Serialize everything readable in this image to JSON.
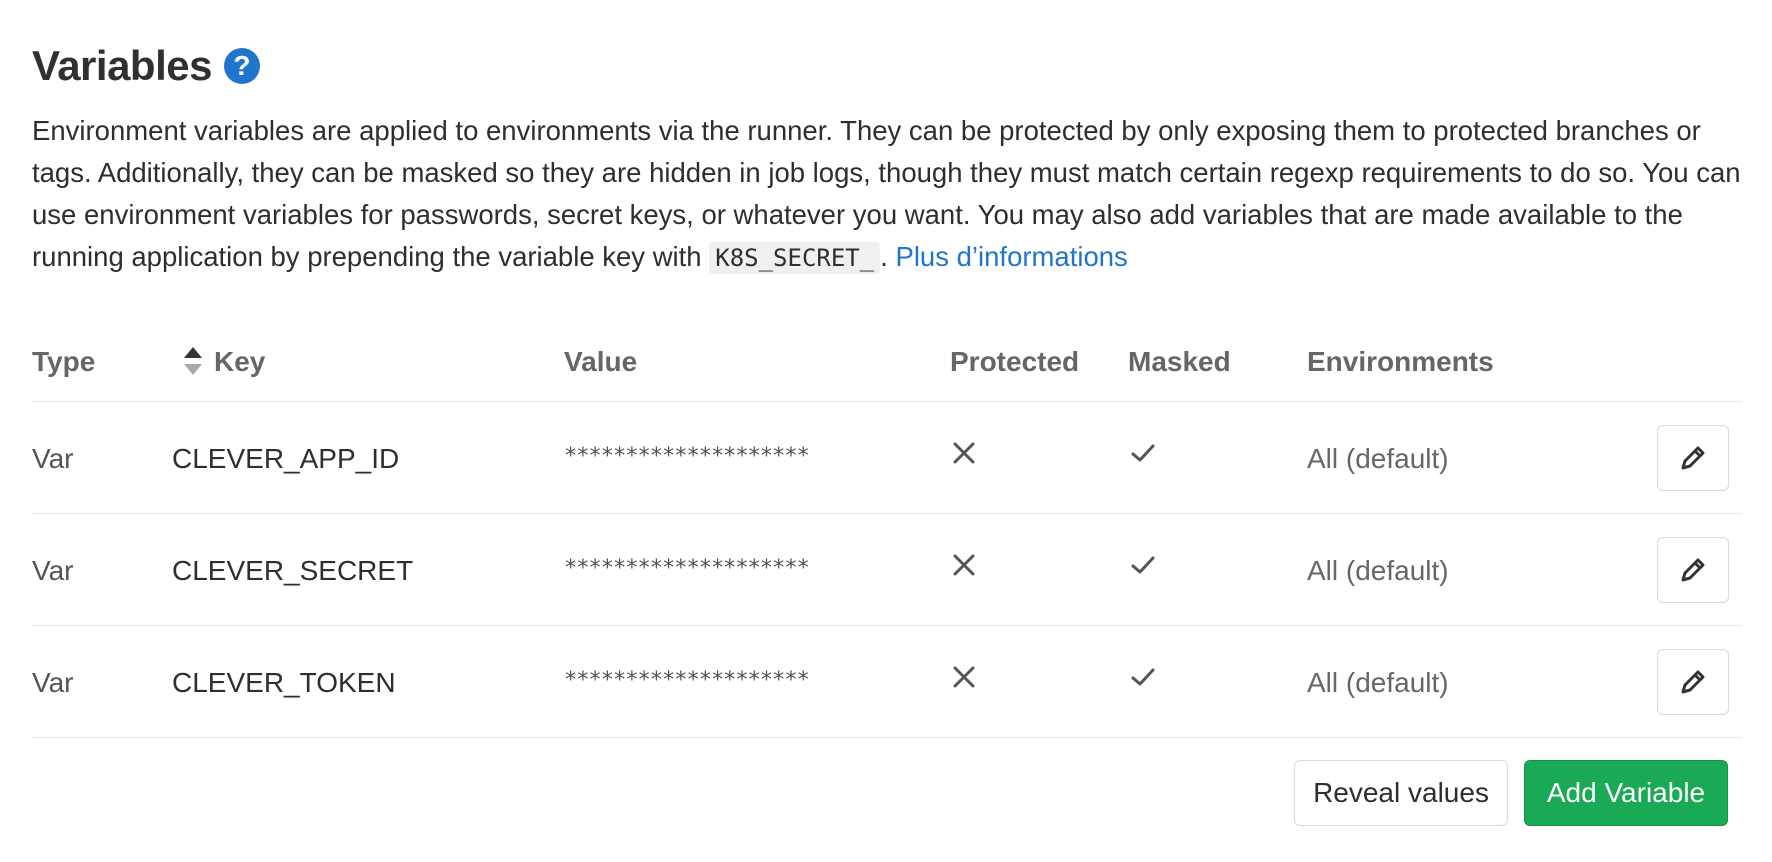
{
  "section": {
    "title": "Variables",
    "help_icon": "question-circle-icon",
    "description_text": "Environment variables are applied to environments via the runner. They can be protected by only exposing them to protected branches or tags. Additionally, they can be masked so they are hidden in job logs, though they must match certain regexp requirements to do so. You can use environment variables for passwords, secret keys, or whatever you want. You may also add variables that are made available to the running application by prepending the variable key with ",
    "description_code": "K8S_SECRET_",
    "description_sep": ".",
    "more_info_link": "Plus d’informations"
  },
  "table": {
    "headers": {
      "type": "Type",
      "key": "Key",
      "value": "Value",
      "protected": "Protected",
      "masked": "Masked",
      "environments": "Environments"
    },
    "rows": [
      {
        "type": "Var",
        "key": "CLEVER_APP_ID",
        "value": "********************",
        "protected": "no",
        "masked": "yes",
        "environment": "All (default)"
      },
      {
        "type": "Var",
        "key": "CLEVER_SECRET",
        "value": "********************",
        "protected": "no",
        "masked": "yes",
        "environment": "All (default)"
      },
      {
        "type": "Var",
        "key": "CLEVER_TOKEN",
        "value": "********************",
        "protected": "no",
        "masked": "yes",
        "environment": "All (default)"
      }
    ]
  },
  "actions": {
    "reveal_label": "Reveal values",
    "add_label": "Add Variable"
  },
  "colors": {
    "link": "#1f75cb",
    "primary_button": "#1aaa55",
    "heading": "#303030"
  }
}
